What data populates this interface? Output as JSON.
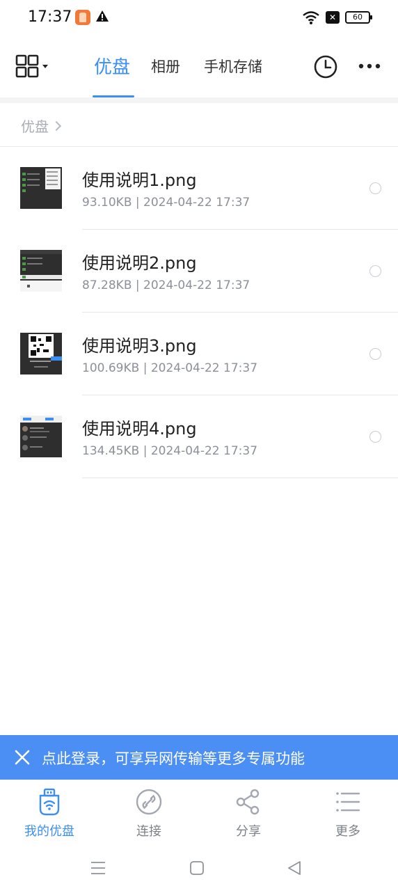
{
  "status_bar": {
    "time": "17:37",
    "battery": "60",
    "icons": [
      "app-notification-icon",
      "warning-icon",
      "wifi-icon",
      "sim-off-icon",
      "battery-icon"
    ]
  },
  "header": {
    "tabs": [
      {
        "label": "优盘",
        "active": true
      },
      {
        "label": "相册",
        "active": false
      },
      {
        "label": "手机存储",
        "active": false
      }
    ],
    "accent_color": "#3a8ef6"
  },
  "breadcrumb": {
    "label": "优盘"
  },
  "files": [
    {
      "name": "使用说明1.png",
      "meta": "93.10KB | 2024-04-22 17:37"
    },
    {
      "name": "使用说明2.png",
      "meta": "87.28KB | 2024-04-22 17:37"
    },
    {
      "name": "使用说明3.png",
      "meta": "100.69KB | 2024-04-22 17:37"
    },
    {
      "name": "使用说明4.png",
      "meta": "134.45KB | 2024-04-22 17:37"
    }
  ],
  "login_banner": {
    "text": "点此登录，可享异网传输等更多专属功能",
    "color": "#4b8ff5"
  },
  "bottom_nav": {
    "items": [
      {
        "label": "我的优盘",
        "icon": "usb-drive-icon",
        "active": true
      },
      {
        "label": "连接",
        "icon": "link-icon",
        "active": false
      },
      {
        "label": "分享",
        "icon": "share-icon",
        "active": false
      },
      {
        "label": "更多",
        "icon": "list-icon",
        "active": false
      }
    ]
  }
}
